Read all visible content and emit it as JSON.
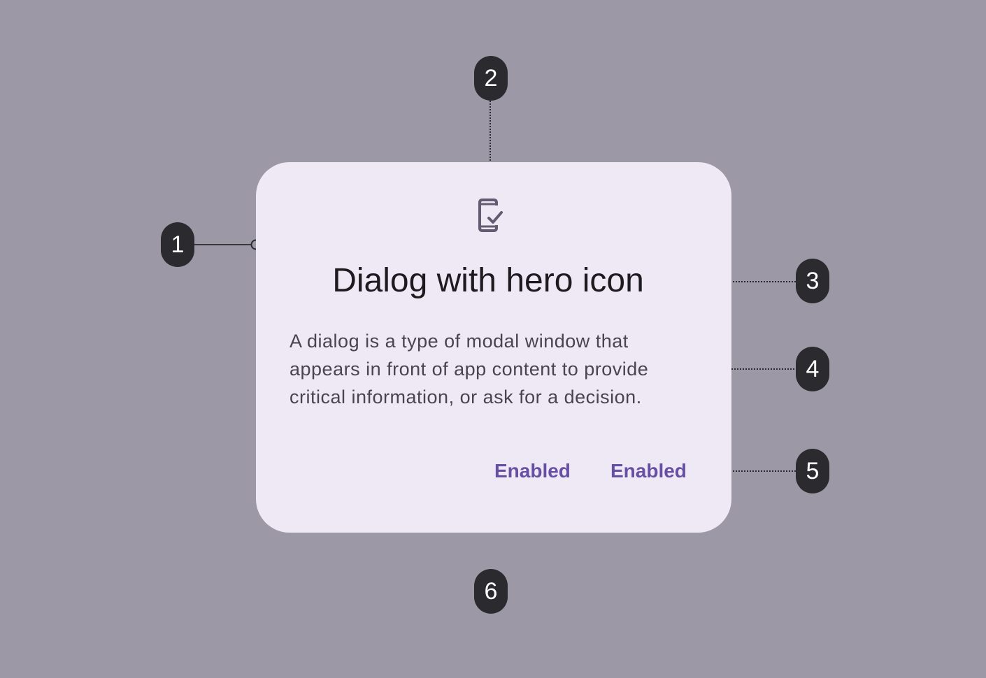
{
  "dialog": {
    "hero_icon": "phone-check-icon",
    "title": "Dialog with hero icon",
    "body_lines": [
      "A dialog is a type of modal window that",
      "appears in front of app content to provide",
      "critical information, or ask for a decision."
    ],
    "actions": [
      "Enabled",
      "Enabled"
    ]
  },
  "callouts": [
    "1",
    "2",
    "3",
    "4",
    "5",
    "6"
  ],
  "colors": {
    "background": "#9C98A6",
    "surface": "#EFE9F5",
    "primary": "#6750A4",
    "badge": "#2B2A2E"
  }
}
